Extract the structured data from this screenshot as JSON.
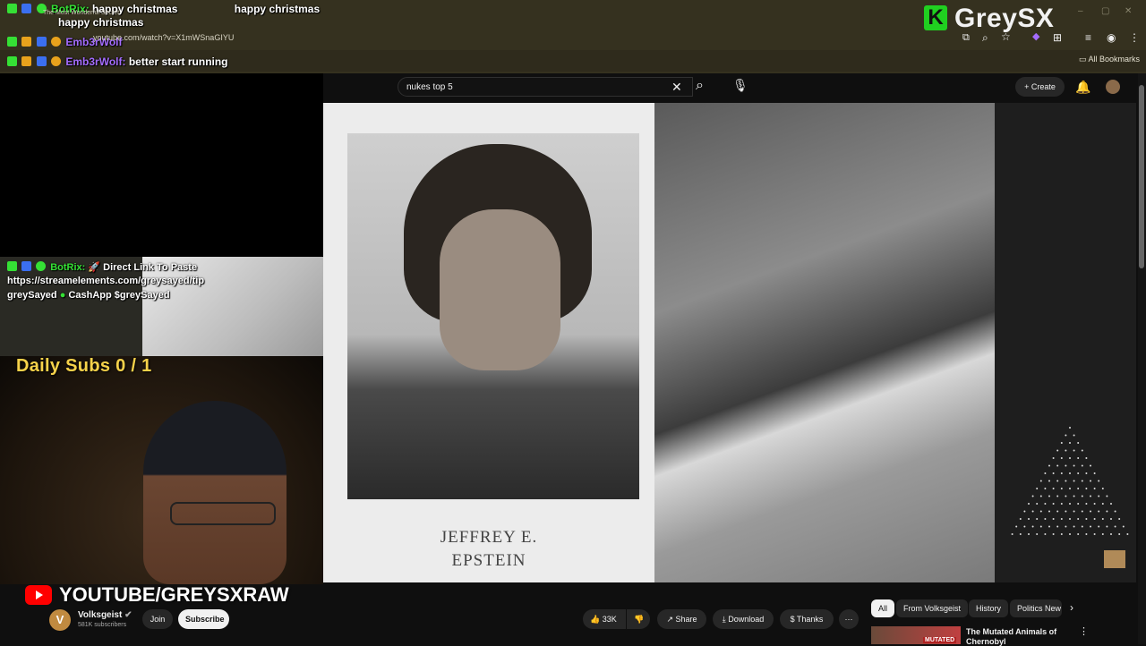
{
  "browser": {
    "url": "youtube.com/watch?v=X1mWSnaGIYU",
    "all_bookmarks": "All Bookmarks",
    "window_title_faint": "The Most Wonderful Secret"
  },
  "stream_overlay": {
    "logo": "GreySX",
    "logo_letter": "K",
    "chat": [
      {
        "user": "BotRix:",
        "message": "happy christmas",
        "message2": "happy christmas",
        "extra": "happy christmas",
        "user_color": "#35e035"
      },
      {
        "user": "Emb3rWolf",
        "message": "",
        "user_color": "#a46cff"
      },
      {
        "user": "Emb3rWolf:",
        "message": "better start running",
        "user_color": "#a46cff"
      }
    ],
    "botrix_message": {
      "user": "BotRix:",
      "line1": "Direct Link To Paste",
      "line2": "https://streamelements.com/greysayed/tip",
      "line3": "greySayed",
      "line3b": "CashApp",
      "line3c": "$greySayed"
    },
    "daily_subs": "Daily Subs  0 / 1",
    "youtube_handle": "YOUTUBE/GREYSXRAW",
    "subs_counter_hidden_behind": "The Most Wonderful Secret"
  },
  "youtube": {
    "search_query": "nukes top 5",
    "create_label": "Create",
    "video": {
      "caption_line1": "JEFFREY E.",
      "caption_line2": "EPSTEIN"
    },
    "channel": {
      "name": "Volksgeist",
      "subscribers": "581K subscribers",
      "avatar_letter": "V"
    },
    "buttons": {
      "join": "Join",
      "subscribe": "Subscribe",
      "likes": "33K",
      "share": "Share",
      "download": "Download",
      "thanks": "Thanks"
    },
    "chips": [
      "All",
      "From Volksgeist",
      "History",
      "Politics New"
    ],
    "recommendation": {
      "title_line1": "The Mutated Animals of",
      "title_line2": "Chernobyl",
      "thumb_label": "MUTATED"
    }
  },
  "colors": {
    "browser_bg": "#35311f",
    "yt_bg": "#0f0f0f",
    "accent_green": "#20d020",
    "daily_subs": "#f6d24a",
    "yt_red": "#ff0000"
  }
}
